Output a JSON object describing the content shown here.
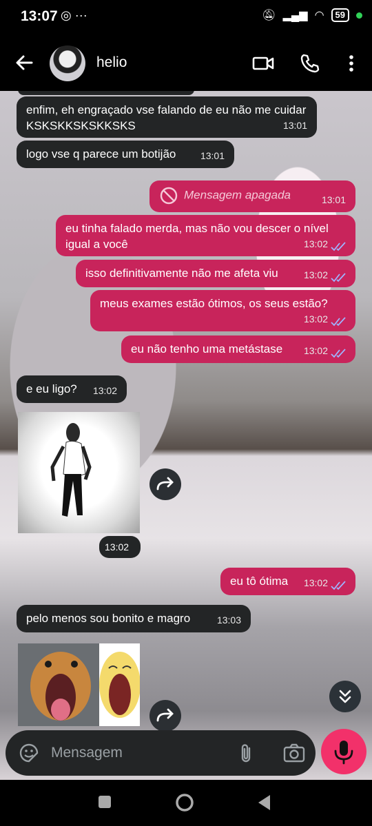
{
  "status": {
    "time": "13:07",
    "battery": "59"
  },
  "header": {
    "contact_name": "helio"
  },
  "messages": [
    {
      "dir": "in",
      "text": "enfim, eh engraçado vse falando de eu não me cuidar KSKSKKSKSKKSKS",
      "time": "13:01"
    },
    {
      "dir": "in",
      "text": "logo vse q parece um botijão",
      "time": "13:01"
    },
    {
      "dir": "out",
      "text": "Mensagem apagada",
      "time": "13:01",
      "deleted": true
    },
    {
      "dir": "out",
      "text": "eu tinha falado merda, mas não vou descer o nível igual a você",
      "time": "13:02"
    },
    {
      "dir": "out",
      "text": "isso definitivamente não me afeta viu",
      "time": "13:02"
    },
    {
      "dir": "out",
      "text": "meus exames estão ótimos, os seus estão?",
      "time": "13:02"
    },
    {
      "dir": "out",
      "text": "eu não tenho uma metástase",
      "time": "13:02"
    },
    {
      "dir": "in",
      "text": "e eu ligo?",
      "time": "13:02"
    },
    {
      "dir": "in",
      "type": "gif",
      "time": "13:02"
    },
    {
      "dir": "out",
      "text": "eu tô ótima",
      "time": "13:02"
    },
    {
      "dir": "in",
      "text": "pelo menos sou bonito e magro",
      "time": "13:03"
    },
    {
      "dir": "in",
      "type": "image"
    }
  ],
  "composer": {
    "placeholder": "Mensagem"
  },
  "colors": {
    "outgoing": "#c8245b",
    "incoming": "#232526",
    "mic": "#f2316a",
    "read_ticks": "#9fb4ff"
  }
}
